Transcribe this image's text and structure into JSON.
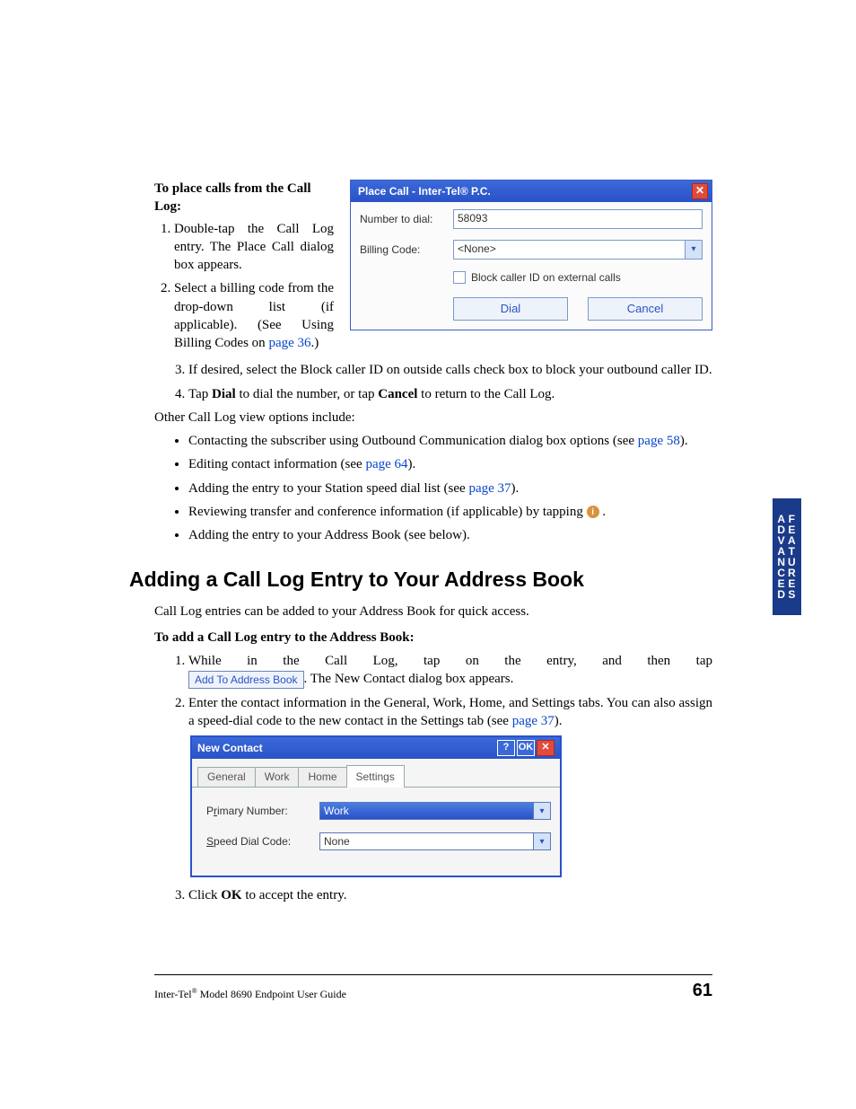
{
  "sideTab": {
    "line1": "ADVANCED",
    "line2": "FEATURES"
  },
  "section1": {
    "lead": "To place calls from the Call Log:",
    "steps12": [
      "Double-tap the Call Log entry. The Place Call dialog box appears.",
      "Select a billing code from the drop-down list (if applicable). (See Using Billing Codes on "
    ],
    "link36": "page 36",
    "step3": "If desired, select the Block caller ID on outside calls check box to block your outbound caller ID.",
    "step4a": "Tap ",
    "step4b": "Dial",
    "step4c": " to dial the number, or tap ",
    "step4d": "Cancel",
    "step4e": " to return to the Call Log."
  },
  "placeCall": {
    "title": "Place Call - Inter-Tel® P.C.",
    "numberLabel": "Number to dial:",
    "numberValue": "58093",
    "billingLabel": "Billing Code:",
    "billingValue": "<None>",
    "blockLabel": "Block caller ID on external calls",
    "dial": "Dial",
    "cancel": "Cancel"
  },
  "otherIntro": "Other Call Log view options include:",
  "bullets": {
    "b1a": "Contacting the subscriber using Outbound Communication dialog box options (see ",
    "b1link": "page 58",
    "b1b": ").",
    "b2a": "Editing contact information (see ",
    "b2link": "page 64",
    "b2b": ").",
    "b3a": "Adding the entry to your Station speed dial list (see ",
    "b3link": "page 37",
    "b3b": ").",
    "b4": "Reviewing transfer and conference information (if applicable) by tapping ",
    "b4post": " .",
    "b5": "Adding the entry to your Address Book (see below)."
  },
  "heading2": "Adding a Call Log Entry to Your Address Book",
  "para2": "Call Log entries can be added to your Address Book for quick access.",
  "lead2": "To add a Call Log entry to the Address Book:",
  "steps2": {
    "s1a": "While in the Call Log, tap on the entry, and then tap ",
    "s1btn": "Add To Address Book",
    "s1b": ". The New Contact dialog box appears.",
    "s2a": "Enter the contact information in the General, Work, Home, and Settings tabs. You can also assign a speed-dial code to the new contact in the Settings tab (see ",
    "s2link": "page 37",
    "s2b": ").",
    "s3a": "Click ",
    "s3b": "OK",
    "s3c": " to accept the entry."
  },
  "newContact": {
    "title": "New Contact",
    "help": "?",
    "ok": "OK",
    "tabs": {
      "general": "General",
      "work": "Work",
      "home": "Home",
      "settings": "Settings"
    },
    "primLabelPre": "P",
    "primLabelU": "r",
    "primLabelPost": "imary Number:",
    "primValue": "Work",
    "speedLabelPre": "",
    "speedLabelU": "S",
    "speedLabelPost": "peed Dial Code:",
    "speedValue": "None"
  },
  "footer": {
    "textA": "Inter-Tel",
    "textB": " Model 8690 Endpoint User Guide",
    "page": "61"
  },
  "glyphs": {
    "x": "✕",
    "chev": "▾",
    "info": "i"
  }
}
